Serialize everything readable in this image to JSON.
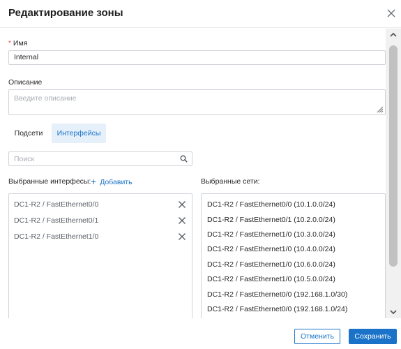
{
  "dialog": {
    "title": "Редактирование зоны"
  },
  "form": {
    "name_required_mark": "*",
    "name_label": "Имя",
    "name_value": "Internal",
    "description_label": "Описание",
    "description_placeholder": "Введите описание"
  },
  "tabs": [
    {
      "label": "Подсети",
      "active": false
    },
    {
      "label": "Интерфейсы",
      "active": true
    }
  ],
  "search": {
    "placeholder": "Поиск"
  },
  "interfaces": {
    "label": "Выбранные интерфесы:",
    "add_label": "Добавить",
    "items": [
      "DC1-R2 / FastEthernet0/0",
      "DC1-R2 / FastEthernet0/1",
      "DC1-R2 / FastEthernet1/0"
    ]
  },
  "networks": {
    "label": "Выбранные сети:",
    "items": [
      "DC1-R2 / FastEthernet0/0 (10.1.0.0/24)",
      "DC1-R2 / FastEthernet0/1 (10.2.0.0/24)",
      "DC1-R2 / FastEthernet1/0 (10.3.0.0/24)",
      "DC1-R2 / FastEthernet1/0 (10.4.0.0/24)",
      "DC1-R2 / FastEthernet1/0 (10.6.0.0/24)",
      "DC1-R2 / FastEthernet1/0 (10.5.0.0/24)",
      "DC1-R2 / FastEthernet0/0 (192.168.1.0/30)",
      "DC1-R2 / FastEthernet0/0 (192.168.1.0/24)"
    ]
  },
  "footer": {
    "cancel_label": "Отменить",
    "save_label": "Сохранить"
  },
  "colors": {
    "accent": "#1a73c8",
    "required": "#e34b4b",
    "active_tab_bg": "#e6f0fa"
  },
  "icons": {
    "close": "close-icon",
    "search": "search-icon",
    "add": "plus-icon",
    "remove": "close-icon",
    "resize": "resize-handle-icon",
    "scroll_up": "chevron-up-icon",
    "scroll_down": "chevron-down-icon"
  }
}
